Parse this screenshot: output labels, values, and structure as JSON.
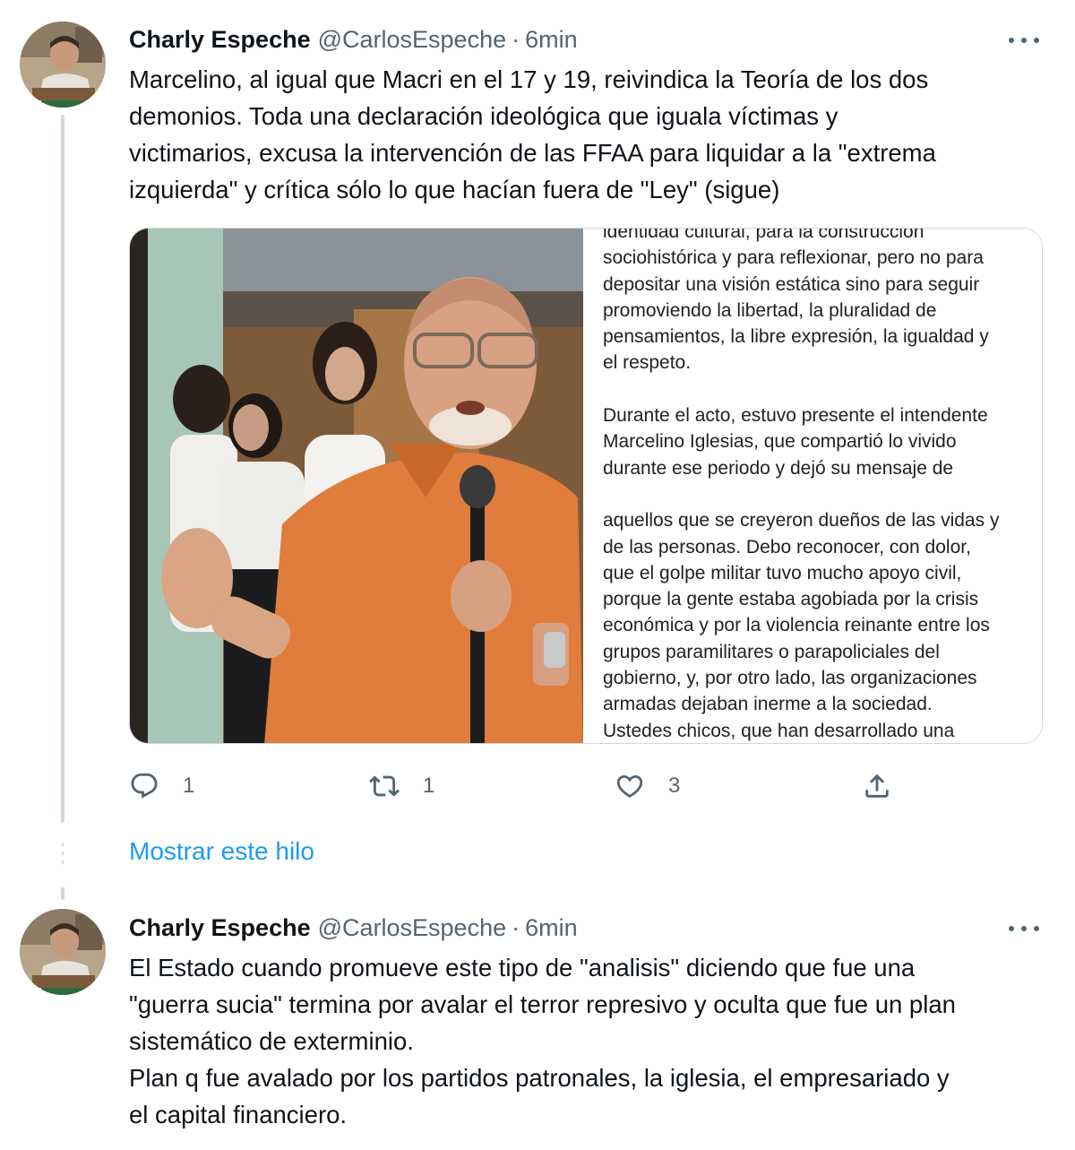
{
  "tweets": [
    {
      "author_name": "Charly Espeche",
      "handle": "@CarlosEspeche",
      "separator": "·",
      "time": "6min",
      "text": "Marcelino, al igual que Macri en el 17 y 19, reivindica la Teoría de los dos\ndemonios. Toda una declaración ideológica que iguala víctimas y\nvictimarios, excusa la intervención de las FFAA para liquidar a la \"extrema\nizquierda\" y crítica sólo lo que hacían fuera de \"Ley\" (sigue)",
      "media_article_text": "identidad cultural, para la construcción\nsociohistórica y para reflexionar, pero no para\ndepositar una visión estática sino para seguir\npromoviendo la libertad, la pluralidad de\npensamientos, la libre expresión, la igualdad y\nel respeto.\n\nDurante el acto, estuvo presente el intendente\nMarcelino Iglesias, que compartió lo vivido\ndurante ese periodo y dejó su mensaje de\n\naquellos que se creyeron dueños de las vidas y\nde las personas. Debo reconocer, con dolor,\nque el golpe militar tuvo mucho apoyo civil,\nporque la gente estaba agobiada por la crisis\neconómica y por la violencia reinante entre los\ngrupos paramilitares o parapoliciales del\ngobierno, y, por otro lado, las organizaciones\narmadas dejaban inerme a la sociedad.\nUstedes chicos, que han desarrollado una\nvisión crítica, les pido que dialoguen con sus",
      "reply_count": "1",
      "retweet_count": "1",
      "like_count": "3"
    },
    {
      "author_name": "Charly Espeche",
      "handle": "@CarlosEspeche",
      "separator": "·",
      "time": "6min",
      "text": "El Estado cuando promueve este tipo de \"analisis\" diciendo que fue una\n\"guerra sucia\" termina por avalar el terror represivo y oculta que fue un plan\nsistemático de exterminio.\nPlan q fue avalado por los partidos patronales, la iglesia, el empresariado y\nel capital financiero."
    }
  ],
  "show_thread_label": "Mostrar este hilo",
  "icons": {
    "more": "more-horizontal-icon",
    "reply": "reply-icon",
    "retweet": "retweet-icon",
    "like": "heart-icon",
    "share": "share-icon"
  },
  "colors": {
    "text": "#0f1419",
    "secondary": "#536471",
    "link": "#1d9bf0",
    "border": "#cfd9de"
  }
}
